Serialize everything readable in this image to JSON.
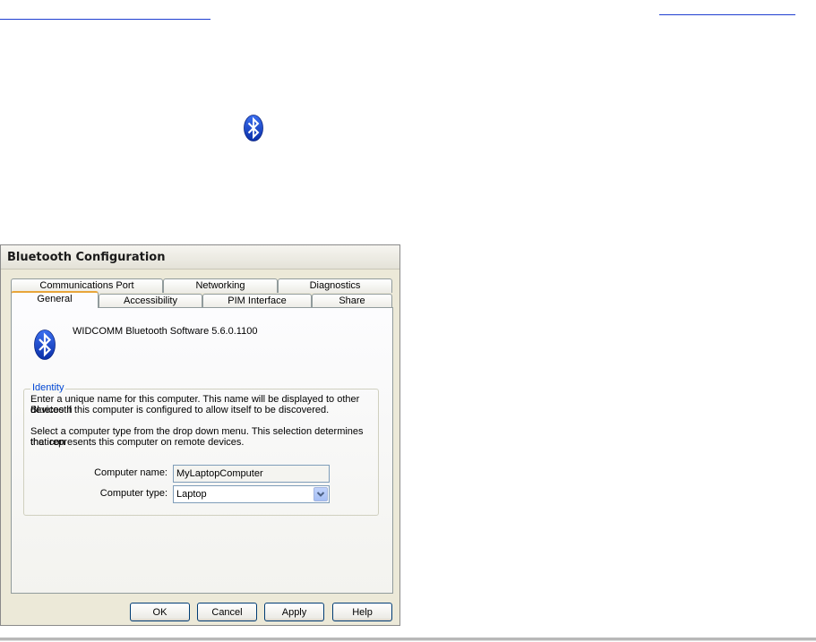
{
  "dialog": {
    "title": "Bluetooth Configuration",
    "tabs_row1": [
      "Communications Port",
      "Networking",
      "Diagnostics"
    ],
    "tabs_row2": [
      "General",
      "Accessibility",
      "PIM Interface",
      "Share"
    ],
    "software_version": "WIDCOMM Bluetooth Software 5.6.0.1100",
    "identity": {
      "legend": "Identity",
      "line1": "Enter a unique name for this computer.  This name will be displayed to other Bluetooth",
      "line2": "devices if this computer is configured to allow itself to be discovered.",
      "line3": "Select a computer type from the drop down menu.  This selection determines the icon",
      "line4": "that represents this computer on remote devices.",
      "computer_name_label": "Computer name:",
      "computer_name_value": "MyLaptopComputer",
      "computer_type_label": "Computer type:",
      "computer_type_value": "Laptop"
    },
    "buttons": {
      "ok": "OK",
      "cancel": "Cancel",
      "apply": "Apply",
      "help": "Help"
    }
  },
  "icons": {
    "bluetooth_small": "bluetooth-icon",
    "bluetooth_large": "bluetooth-icon"
  },
  "colors": {
    "bluetooth_blue": "#1f4fd4",
    "link_blue": "#1f3fd0",
    "active_tab_accent": "#e8a53a",
    "legend_blue": "#0046d5"
  }
}
